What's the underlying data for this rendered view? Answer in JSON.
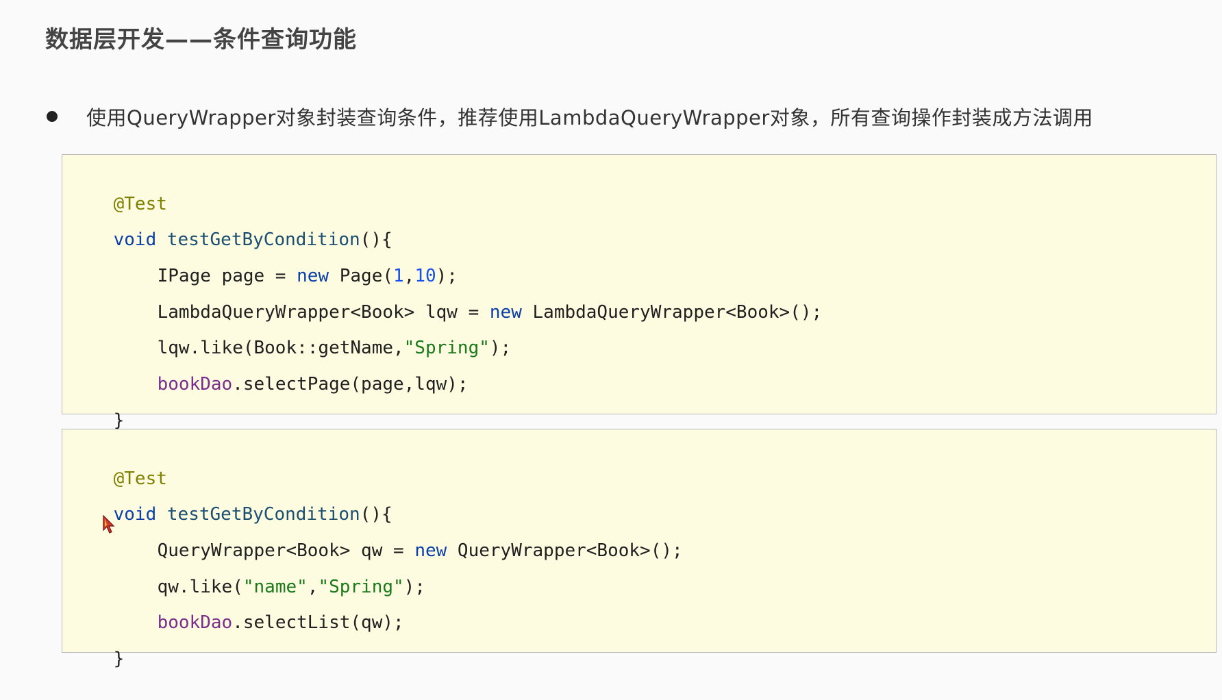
{
  "slide": {
    "title": "数据层开发——条件查询功能",
    "bullet_text": "使用QueryWrapper对象封装查询条件，推荐使用LambdaQueryWrapper对象，所有查询操作封装成方法调用"
  },
  "code_block_1": {
    "line1": {
      "annotation": "@Test"
    },
    "line2": {
      "kw": "void",
      "name": "testGetByCondition",
      "rest": "(){"
    },
    "line3": {
      "a": "IPage page = ",
      "kw": "new",
      "b": " Page(",
      "n1": "1",
      "c": ",",
      "n2": "10",
      "d": ");"
    },
    "line4": {
      "a": "LambdaQueryWrapper<Book> lqw = ",
      "kw": "new",
      "b": " LambdaQueryWrapper<Book>();"
    },
    "line5": {
      "a": "lqw.like(Book::getName,",
      "str": "\"Spring\"",
      "b": ");"
    },
    "line6": {
      "field": "bookDao",
      "rest": ".selectPage(page,lqw);"
    },
    "line7": {
      "text": "}"
    }
  },
  "code_block_2": {
    "line1": {
      "annotation": "@Test"
    },
    "line2": {
      "kw": "void",
      "name": "testGetByCondition",
      "rest": "(){"
    },
    "line3": {
      "a": "QueryWrapper<Book> qw = ",
      "kw": "new",
      "b": " QueryWrapper<Book>();"
    },
    "line4": {
      "a": "qw.like(",
      "s1": "\"name\"",
      "c": ",",
      "s2": "\"Spring\"",
      "b": ");"
    },
    "line5": {
      "field": "bookDao",
      "rest": ".selectList(qw);"
    },
    "line6": {
      "text": "}"
    }
  },
  "colors": {
    "background": "#fafafa",
    "code_background": "#fdfbe0",
    "annotation": "#808000",
    "keyword": "#0a3ea8",
    "string": "#1a7a1a",
    "field": "#7a2d8c",
    "number": "#1750eb"
  },
  "icons": {
    "cursor": "mouse-pointer-icon"
  }
}
